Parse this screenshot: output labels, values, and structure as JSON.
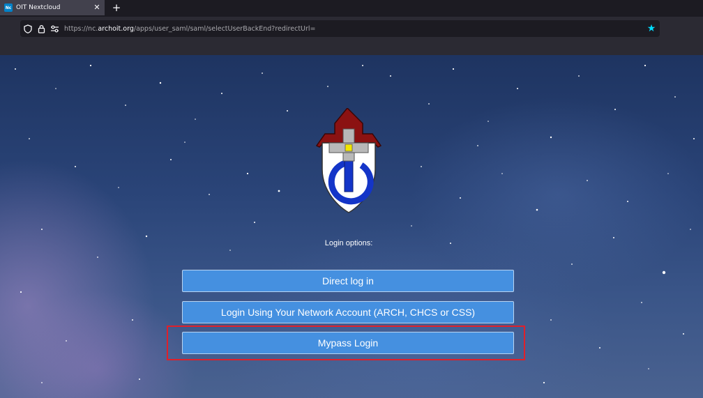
{
  "browser": {
    "tab": {
      "title": "OIT Nextcloud",
      "favicon_text": "Nc",
      "close_glyph": "✕"
    },
    "new_tab_glyph": "+",
    "url": {
      "prefix": "https://nc.",
      "domain": "archoit.org",
      "path": "/apps/user_saml/saml/selectUserBackEnd?redirectUrl="
    },
    "icons": [
      "shield-icon",
      "lock-icon",
      "permissions-icon",
      "bookmark-star-icon"
    ],
    "accent_color": "#00ddff"
  },
  "page": {
    "login_options_label": "Login options:",
    "buttons": [
      {
        "label": "Direct log in"
      },
      {
        "label": "Login Using Your Network Account (ARCH, CHCS or CSS)"
      },
      {
        "label": "Mypass Login"
      }
    ],
    "button_color": "#4590e0",
    "highlight_color": "#e0202a"
  }
}
